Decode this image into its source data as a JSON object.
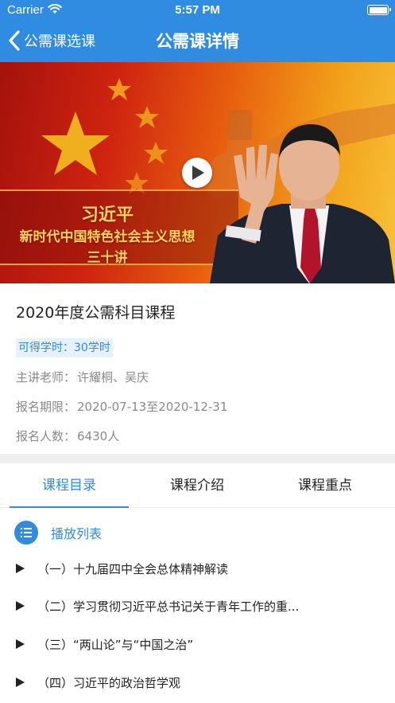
{
  "status_bar": {
    "carrier": "Carrier",
    "time": "5:57 PM"
  },
  "nav": {
    "back_label": "公需课选课",
    "title": "公需课详情"
  },
  "banner": {
    "line1": "习近平",
    "line2": "新时代中国特色社会主义思想",
    "line3": "三十讲",
    "text_color": "#ffd45a"
  },
  "course": {
    "title": "2020年度公需科目课程",
    "hours": "可得学时：30学时",
    "teacher_label": "主讲老师：",
    "teacher_value": "许耀桐、吴庆",
    "period_label": "报名期限：",
    "period_value": "2020-07-13至2020-12-31",
    "count_label": "报名人数：",
    "count_value": "6430人"
  },
  "tabs": [
    {
      "label": "课程目录",
      "active": true
    },
    {
      "label": "课程介绍",
      "active": false
    },
    {
      "label": "课程重点",
      "active": false
    }
  ],
  "playlist": {
    "title": "播放列表",
    "items": [
      "（一）十九届四中全会总体精神解读",
      "（二）学习贯彻习近平总书记关于青年工作的重...",
      "（三）“两山论”与“中国之治”",
      "（四）习近平的政治哲学观"
    ]
  },
  "colors": {
    "accent": "#2f8ce0",
    "badge_bg": "#e6f1fc",
    "muted_text": "#8a8a8a",
    "separator": "#f0f0f0"
  },
  "icons": {
    "back": "chevron-left-icon",
    "wifi": "wifi-icon",
    "battery": "battery-icon",
    "play": "play-icon",
    "playlist": "list-icon",
    "item": "play-triangle-icon"
  }
}
